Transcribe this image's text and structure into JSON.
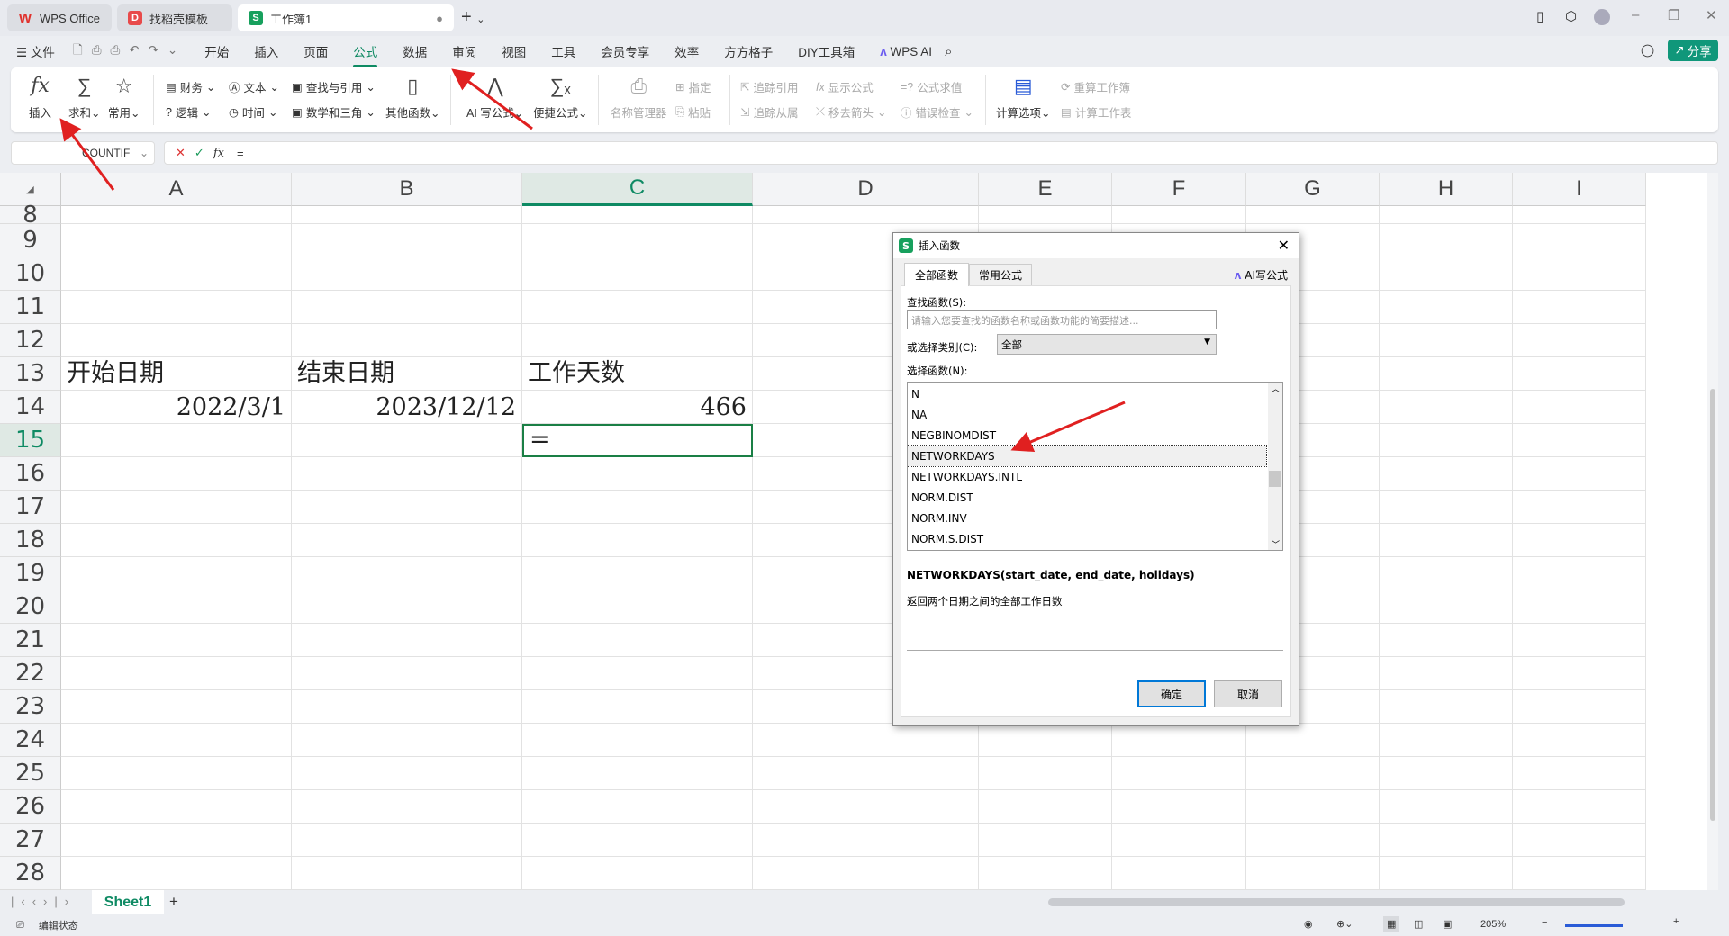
{
  "tabs": [
    {
      "label": "WPS Office",
      "color": "#e0312c"
    },
    {
      "label": "找稻壳模板",
      "color": "#e84a4a"
    },
    {
      "label": "工作簿1",
      "color": "#17a05d",
      "active": true
    }
  ],
  "menu": {
    "file": "文件",
    "items": [
      "开始",
      "插入",
      "页面",
      "公式",
      "数据",
      "审阅",
      "视图",
      "工具",
      "会员专享",
      "效率",
      "方方格子",
      "DIY工具箱"
    ],
    "active": "公式",
    "wps_ai": "WPS AI",
    "share": "分享"
  },
  "ribbon": {
    "insert": "插入",
    "sum": "求和",
    "common": "常用",
    "finance": "财务",
    "text": "文本",
    "lookup": "查找与引用",
    "other": "其他函数",
    "logic": "逻辑",
    "time": "时间",
    "math": "数学和三角",
    "ai_formula": "AI 写公式",
    "quick_formula": "便捷公式",
    "name_mgr": "名称管理器",
    "specify": "指定",
    "paste": "粘贴",
    "trace_prec": "追踪引用",
    "trace_dep": "追踪从属",
    "show_formula": "显示公式",
    "remove_arrows": "移去箭头",
    "eval_formula": "公式求值",
    "error_check": "错误检查",
    "calc_options": "计算选项",
    "recalc_wb": "重算工作簿",
    "calc_sheet": "计算工作表"
  },
  "formula_bar": {
    "name_box": "COUNTIF",
    "fx": "fx",
    "value": "="
  },
  "columns": [
    "A",
    "B",
    "C",
    "D",
    "E",
    "F",
    "G",
    "H",
    "I"
  ],
  "selected_column": "C",
  "rows": [
    8,
    9,
    10,
    11,
    12,
    13,
    14,
    15,
    16,
    17,
    18,
    19,
    20,
    21,
    22,
    23,
    24,
    25,
    26,
    27,
    28
  ],
  "selected_row": 15,
  "cells": {
    "A13": "开始日期",
    "B13": "结束日期",
    "C13": "工作天数",
    "A14": "2022/3/1",
    "B14": "2023/12/12",
    "C14": "466",
    "C15": "="
  },
  "sheet_tabs": {
    "active": "Sheet1",
    "add": "+"
  },
  "status": {
    "mode": "编辑状态",
    "zoom": "205%"
  },
  "dialog": {
    "title": "插入函数",
    "tab_all": "全部函数",
    "tab_common": "常用公式",
    "ai_write": "AI写公式",
    "search_label": "查找函数(S):",
    "search_placeholder": "请输入您要查找的函数名称或函数功能的简要描述...",
    "category_label": "或选择类别(C):",
    "category_value": "全部",
    "select_label": "选择函数(N):",
    "functions": [
      "N",
      "NA",
      "NEGBINOMDIST",
      "NETWORKDAYS",
      "NETWORKDAYS.INTL",
      "NORM.DIST",
      "NORM.INV",
      "NORM.S.DIST"
    ],
    "selected": "NETWORKDAYS",
    "signature": "NETWORKDAYS(start_date, end_date, holidays)",
    "description": "返回两个日期之间的全部工作日数",
    "ok": "确定",
    "cancel": "取消"
  },
  "colors": {
    "accent": "#0e8a63",
    "arrow": "#e02020"
  }
}
